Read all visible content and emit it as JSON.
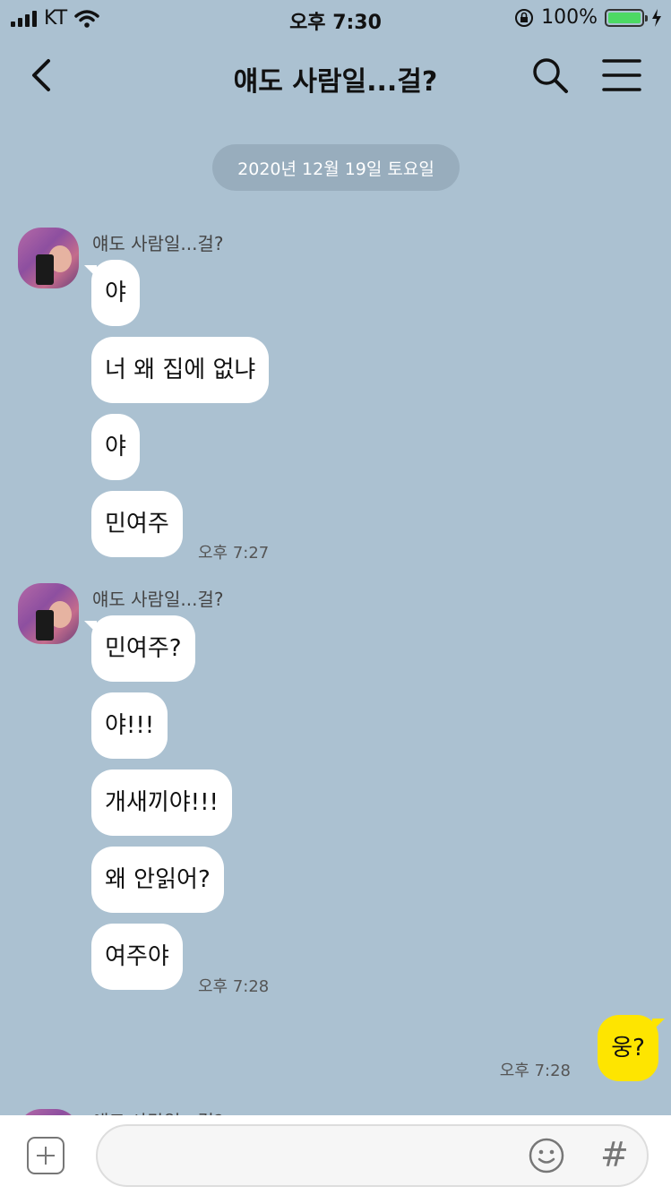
{
  "status_bar": {
    "carrier": "KT",
    "time": "오후 7:30",
    "battery": "100%",
    "battery_level": 1.0
  },
  "header": {
    "title": "얘도 사람일...걸?",
    "icons": [
      "back-icon",
      "search-icon",
      "menu-icon"
    ]
  },
  "date_divider": "2020년 12월 19일 토요일",
  "groups": [
    {
      "sender": "얘도 사람일...걸?",
      "messages": [
        "야",
        "너 왜 집에 없냐",
        "야",
        "민여주"
      ],
      "time": "오후 7:27"
    },
    {
      "sender": "얘도 사람일...걸?",
      "messages": [
        "민여주?",
        "야!!!",
        "개새끼야!!!",
        "왜 안읽어?",
        "여주야"
      ],
      "time": "오후 7:28"
    }
  ],
  "my_message": {
    "text": "웅?",
    "time": "오후 7:28"
  },
  "partial_sender": "얘도 사람일...걸?",
  "colors": {
    "background": "#abc1d1",
    "my_bubble": "#fee500",
    "their_bubble": "#ffffff",
    "battery": "#4cd964"
  },
  "input_bar": {
    "placeholder": "",
    "icons": [
      "plus-icon",
      "emoji-icon",
      "hash-icon"
    ],
    "hash_label": "#"
  }
}
